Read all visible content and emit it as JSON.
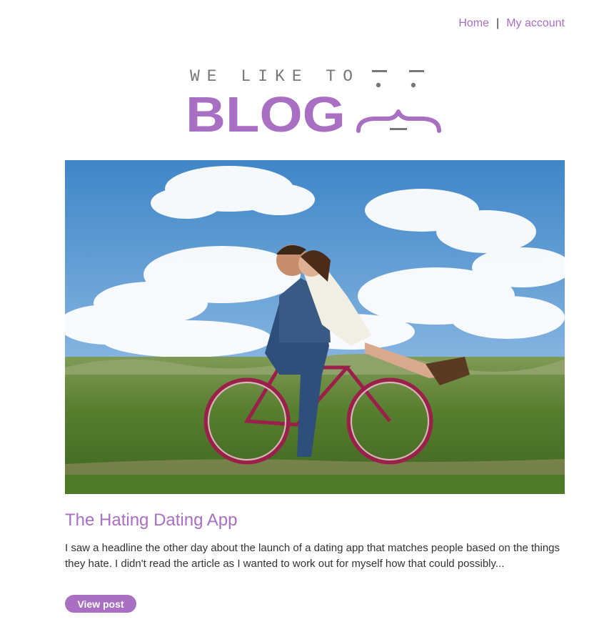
{
  "nav": {
    "home_label": "Home",
    "separator": "|",
    "account_label": "My account"
  },
  "logo": {
    "tagline": "WE LIKE TO",
    "wordmark": "BLOG"
  },
  "post": {
    "title": "The Hating Dating App",
    "excerpt": "I saw a headline the other day about the launch of a dating app that matches people based on the things they hate. I didn't read the article as I wanted to work out for myself how that could possibly...",
    "button_label": "View post"
  },
  "colors": {
    "accent": "#a86fc2",
    "text": "#333333",
    "logo_grey": "#777777"
  }
}
